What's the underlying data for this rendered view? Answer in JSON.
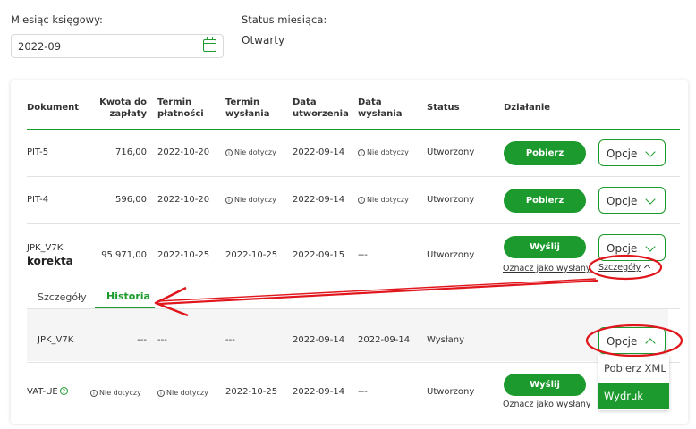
{
  "filters": {
    "month_label": "Miesiąc księgowy:",
    "month_value": "2022-09",
    "status_label": "Status miesiąca:",
    "status_value": "Otwarty"
  },
  "table": {
    "headers": {
      "document": "Dokument",
      "amount_l1": "Kwota do",
      "amount_l2": "zapłaty",
      "payment_l1": "Termin",
      "payment_l2": "płatności",
      "send_l1": "Termin",
      "send_l2": "wysłania",
      "created_l1": "Data",
      "created_l2": "utworzenia",
      "sent_l1": "Data",
      "sent_l2": "wysłania",
      "status": "Status",
      "action": "Działanie"
    },
    "rows": [
      {
        "doc": "PIT-5",
        "amount": "716,00",
        "payment": "2022-10-20",
        "send": "Nie dotyczy",
        "created": "2022-09-14",
        "sent": "Nie dotyczy",
        "status": "Utworzony",
        "button": "Pobierz",
        "options": "Opcje"
      },
      {
        "doc": "PIT-4",
        "amount": "596,00",
        "payment": "2022-10-20",
        "send": "Nie dotyczy",
        "created": "2022-09-14",
        "sent": "Nie dotyczy",
        "status": "Utworzony",
        "button": "Pobierz",
        "options": "Opcje"
      },
      {
        "doc": "JPK_V7K",
        "doc_sub": "korekta",
        "amount": "95 971,00",
        "payment": "2022-10-25",
        "send": "2022-10-25",
        "created": "2022-09-15",
        "sent": "---",
        "status": "Utworzony",
        "button": "Wyślij",
        "mark_sent": "Oznacz jako wysłany",
        "details": "Szczegóły",
        "options": "Opcje"
      },
      {
        "doc": "VAT-UE",
        "amount": "Nie dotyczy",
        "payment": "Nie dotyczy",
        "send": "2022-10-25",
        "created": "2022-09-14",
        "sent": "---",
        "status": "Utworzony",
        "button": "Wyślij",
        "mark_sent": "Oznacz jako wysłany"
      }
    ]
  },
  "details_panel": {
    "tabs": [
      "Szczegóły",
      "Historia"
    ],
    "active_tab": "Historia",
    "history_row": {
      "doc": "JPK_V7K",
      "amount": "---",
      "payment": "---",
      "send": "---",
      "created": "2022-09-14",
      "sent": "2022-09-14",
      "status": "Wysłany",
      "options": "Opcje"
    },
    "dropdown_items": [
      "Pobierz XML",
      "Wydruk"
    ]
  },
  "colors": {
    "accent": "#1c9a2d",
    "annotation": "#e0161c"
  }
}
